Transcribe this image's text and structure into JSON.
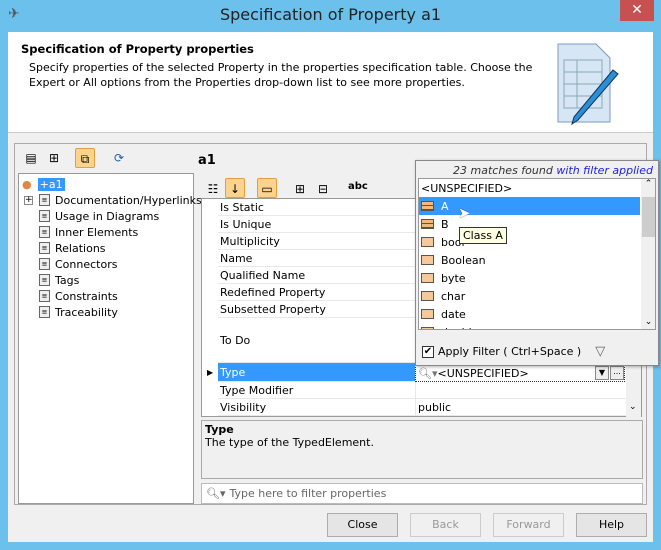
{
  "window": {
    "title": "Specification of Property a1",
    "close": "✕"
  },
  "header": {
    "title": "Specification of Property properties",
    "description": "Specify properties of the selected Property in the properties specification table. Choose the Expert or All options from the Properties drop-down list to see more properties."
  },
  "tree": {
    "root": "+a1",
    "items": [
      "Documentation/Hyperlinks",
      "Usage in Diagrams",
      "Inner Elements",
      "Relations",
      "Connectors",
      "Tags",
      "Constraints",
      "Traceability"
    ]
  },
  "element_name": "a1",
  "table": {
    "rows": [
      {
        "key": "Is Static",
        "value": ""
      },
      {
        "key": "Is Unique",
        "value": ""
      },
      {
        "key": "Multiplicity",
        "value": ""
      },
      {
        "key": "Name",
        "value": ""
      },
      {
        "key": "Qualified Name",
        "value": ""
      },
      {
        "key": "Redefined Property",
        "value": ""
      },
      {
        "key": "Subsetted Property",
        "value": ""
      },
      {
        "key": "To Do",
        "value": ""
      },
      {
        "key": "Type",
        "value": "<UNSPECIFIED>"
      },
      {
        "key": "Type Modifier",
        "value": ""
      },
      {
        "key": "Visibility",
        "value": "public"
      }
    ]
  },
  "popup": {
    "matches": "23 matches found",
    "filter_note": "with filter applied",
    "items": [
      "<UNSPECIFIED>",
      "A",
      "B",
      "bool",
      "Boolean",
      "byte",
      "char",
      "date",
      "double"
    ],
    "tooltip": "Class A",
    "apply_filter": "Apply Filter ( Ctrl+Space )",
    "apply_checked": true
  },
  "description": {
    "title": "Type",
    "text": "The type of the TypedElement."
  },
  "filter": {
    "placeholder": "Type here to filter properties"
  },
  "buttons": {
    "close": "Close",
    "back": "Back",
    "forward": "Forward",
    "help": "Help"
  },
  "toolbar": {
    "abc": "abc"
  }
}
